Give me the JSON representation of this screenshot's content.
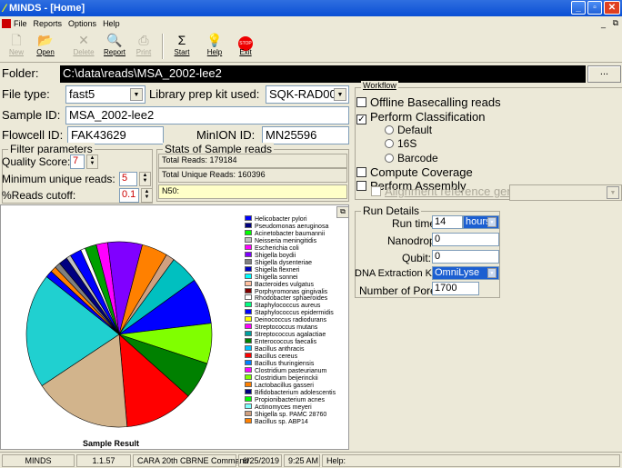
{
  "window": {
    "title": "MINDS - [Home]"
  },
  "menu": [
    "File",
    "Reports",
    "Options",
    "Help"
  ],
  "toolbar": [
    {
      "label": "New",
      "icon": "new-icon",
      "enabled": false
    },
    {
      "label": "Open",
      "icon": "open-icon",
      "enabled": true
    },
    {
      "label": "Delete",
      "icon": "delete-icon",
      "enabled": false
    },
    {
      "label": "Report",
      "icon": "report-icon",
      "enabled": true
    },
    {
      "label": "Print",
      "icon": "print-icon",
      "enabled": false
    },
    {
      "label": "Start",
      "icon": "sigma-icon",
      "enabled": true
    },
    {
      "label": "Help",
      "icon": "help-icon",
      "enabled": true
    },
    {
      "label": "Exit",
      "icon": "stop-icon",
      "enabled": true
    }
  ],
  "folder": {
    "label": "Folder:",
    "value": "C:\\data\\reads\\MSA_2002-lee2",
    "browse": "..."
  },
  "file_type": {
    "label": "File type:",
    "value": "fast5"
  },
  "library": {
    "label": "Library prep kit used:",
    "value": "SQK-RAD004"
  },
  "sample_id": {
    "label": "Sample ID:",
    "value": "MSA_2002-lee2"
  },
  "flowcell": {
    "label": "Flowcell ID:",
    "value": "FAK43629"
  },
  "minion": {
    "label": "MinION ID:",
    "value": "MN25596"
  },
  "filter": {
    "title": "Filter parameters",
    "quality_label": "Quality Score:",
    "quality": "7",
    "min_reads_label": "Minimum unique reads:",
    "min_reads": "5",
    "cutoff_label": "%Reads cutoff:",
    "cutoff": "0.1"
  },
  "stats": {
    "title": "Stats of Sample reads",
    "total": "Total Reads: 179184",
    "unique": "Total Unique Reads: 160396",
    "n50": "N50:"
  },
  "workflow": {
    "title": "Workflow",
    "offline": "Offline Basecalling reads",
    "classify": "Perform Classification",
    "opt_default": "Default",
    "opt_16s": "16S",
    "opt_barcode": "Barcode",
    "coverage": "Compute Coverage",
    "assembly": "Perform Assembly",
    "align": "Alignment reference genome:"
  },
  "run": {
    "title": "Run Details",
    "runtime_label": "Run time:",
    "runtime": "14",
    "unit": "hours",
    "nanodrop_label": "Nanodrop:",
    "nanodrop": "0",
    "qubit_label": "Qubit:",
    "qubit": "0",
    "kit_label": "DNA Extraction Kit:",
    "kit": "OmniLyse",
    "pores_label": "Number of Pores:",
    "pores": "1700"
  },
  "chart_data": {
    "type": "pie",
    "title": "Sample Result",
    "series_colors": [
      "#0000ff",
      "#000080",
      "#00ff00",
      "#c0c0c0",
      "#ff00ff",
      "#8000ff",
      "#808080",
      "#0000c0",
      "#00ffff",
      "#ffc0a0",
      "#800000",
      "#ffffff",
      "#00ff80",
      "#0000ff",
      "#ffff00",
      "#ff00ff",
      "#00a0a0",
      "#008000",
      "#00c0ff",
      "#ff0000",
      "#0080ff",
      "#ff00ff",
      "#80ff00",
      "#ff8000",
      "#000080",
      "#00ff00",
      "#80ffff",
      "#d0a080",
      "#ff8000",
      "#00c0c0",
      "#0000ff"
    ],
    "categories": [
      "Helicobacter pylori",
      "Pseudomonas aeruginosa",
      "Acinetobacter baumannii",
      "Neisseria meningitidis",
      "Escherichia coli",
      "Shigella boydii",
      "Shigella dysenteriae",
      "Shigella flexneri",
      "Shigella sonnei",
      "Bacteroides vulgatus",
      "Porphyromonas gingivalis",
      "Rhodobacter sphaeroides",
      "Staphylococcus aureus",
      "Staphylococcus epidermidis",
      "Deinococcus radiodurans",
      "Streptococcus mutans",
      "Streptococcus agalactiae",
      "Enterococcus faecalis",
      "Bacillus anthracis",
      "Bacillus cereus",
      "Bacillus thuringiensis",
      "Clostridium pasteurianum",
      "Clostridium beijerinckii",
      "Lactobacillus gasseri",
      "Bifidobacterium adolescentis",
      "Propionibacterium acnes",
      "Actinomyces meyeri",
      "Shigella sp. PAMC 28760",
      "Bacillus sp. ABP14"
    ],
    "slices": [
      {
        "color": "#ff00ff",
        "value": 2
      },
      {
        "color": "#8000ff",
        "value": 6
      },
      {
        "color": "#ff8000",
        "value": 4.5
      },
      {
        "color": "#d0a080",
        "value": 1.5
      },
      {
        "color": "#00c0c0",
        "value": 5
      },
      {
        "color": "#0000ff",
        "value": 8
      },
      {
        "color": "#80ff00",
        "value": 7
      },
      {
        "color": "#008000",
        "value": 6.5
      },
      {
        "color": "#ff0000",
        "value": 12
      },
      {
        "color": "#d2b48c",
        "value": 17
      },
      {
        "color": "#20d0d0",
        "value": 20
      },
      {
        "color": "#0000ff",
        "value": 1.2
      },
      {
        "color": "#ff8000",
        "value": 1
      },
      {
        "color": "#808080",
        "value": 1
      },
      {
        "color": "#000080",
        "value": 1.5
      },
      {
        "color": "#c0c0c0",
        "value": 0.8
      },
      {
        "color": "#0000ff",
        "value": 2
      },
      {
        "color": "#ffffff",
        "value": 0.8
      },
      {
        "color": "#00a000",
        "value": 2
      }
    ]
  },
  "status": [
    "MINDS",
    "1.1.57",
    "CARA 20th CBRNE Command",
    "6/25/2019",
    "9:25 AM",
    "Help:"
  ]
}
